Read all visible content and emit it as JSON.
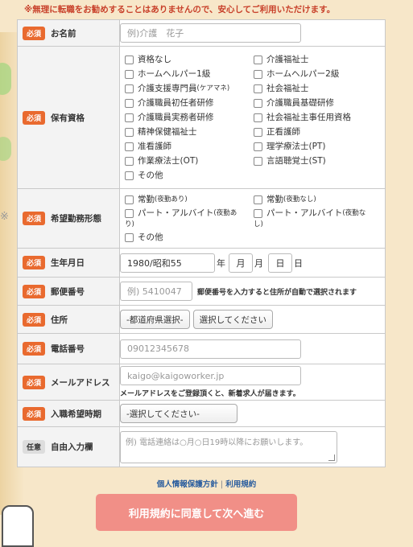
{
  "notice": "※無理に転職をお勧めすることはありませんので、安心してご利用いただけます。",
  "badges": {
    "required": "必須",
    "optional": "任意"
  },
  "name": {
    "label": "お名前",
    "placeholder": "例)介護　花子"
  },
  "qualifications": {
    "label": "保有資格",
    "options": [
      [
        "資格なし",
        "介護福祉士"
      ],
      [
        "ホームヘルパー1級",
        "ホームヘルパー2級"
      ],
      [
        "介護支援専門員",
        "社会福祉士"
      ],
      [
        "介護職員初任者研修",
        "介護職員基礎研修"
      ],
      [
        "介護職員実務者研修",
        "社会福祉主事任用資格"
      ],
      [
        "精神保健福祉士",
        "正看護師"
      ],
      [
        "准看護師",
        "理学療法士(PT)"
      ],
      [
        "作業療法士(OT)",
        "言語聴覚士(ST)"
      ],
      [
        "その他",
        ""
      ]
    ],
    "caremanager_note": "(ケアマネ)"
  },
  "employment": {
    "label": "希望勤務形態",
    "opt1_main": "常勤",
    "opt1_sub": "(夜勤あり)",
    "opt2_main": "常勤",
    "opt2_sub": "(夜勤なし)",
    "opt3_main": "パート・アルバイト",
    "opt3_sub_a": "(夜勤あ",
    "opt3_sub_b": "り)",
    "opt4_main": "パート・アルバイト",
    "opt4_sub_a": "(夜勤な",
    "opt4_sub_b": "し)",
    "opt5": "その他"
  },
  "birthdate": {
    "label": "生年月日",
    "year_value": "1980/昭和55",
    "year_unit": "年",
    "month_value": "月",
    "month_unit": "月",
    "day_value": "日",
    "day_unit": "日"
  },
  "postal": {
    "label": "郵便番号",
    "placeholder": "例) 5410047",
    "note": "郵便番号を入力すると住所が自動で選択されます"
  },
  "address": {
    "label": "住所",
    "prefecture": "-都道府県選択-",
    "city": "選択してください"
  },
  "phone": {
    "label": "電話番号",
    "placeholder": "09012345678"
  },
  "email": {
    "label": "メールアドレス",
    "placeholder": "kaigo@kaigoworker.jp",
    "note": "メールアドレスをご登録頂くと、新着求人が届きます。"
  },
  "start_time": {
    "label": "入職希望時期",
    "value": "-選択してください-"
  },
  "free": {
    "label": "自由入力欄",
    "placeholder": "例) 電話連絡は○月○日19時以降にお願いします。"
  },
  "links": {
    "privacy": "個人情報保護方針",
    "separator": "|",
    "terms": "利用規約"
  },
  "submit": "利用規約に同意して次へ進む"
}
